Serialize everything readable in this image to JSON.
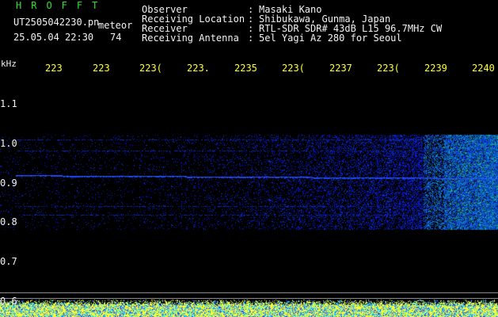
{
  "header": {
    "title": "HROFFT",
    "filename": "UT2505042230.pn",
    "meteor_label": "meteor",
    "date": "25.05.04 22:30",
    "count": "74"
  },
  "info": [
    {
      "key": "Observer",
      "sep": ":",
      "value": "Masaki Kano"
    },
    {
      "key": "Receiving Location",
      "sep": ":",
      "value": "Shibukawa, Gunma, Japan"
    },
    {
      "key": "Receiver",
      "sep": ":",
      "value": "RTL-SDR SDR# 43dB L15 96.7MHz CW"
    },
    {
      "key": "Receiving Antenna",
      "sep": ":",
      "value": "5el Yagi Az 280 for Seoul"
    }
  ],
  "axis": {
    "unit": "kHz",
    "y_labels": [
      "1.1",
      "1.0",
      "0.9",
      "0.8",
      "0.7",
      "0.6"
    ],
    "x_ticks": [
      "223",
      "223",
      "223(",
      "223.",
      "2235",
      "223(",
      "2237",
      "223(",
      "2239",
      "2240"
    ]
  },
  "colors": {
    "background": "#000000",
    "signal": "#1a3cff",
    "header_green": "#2fe02f",
    "tick_yellow": "#ffff3a"
  }
}
